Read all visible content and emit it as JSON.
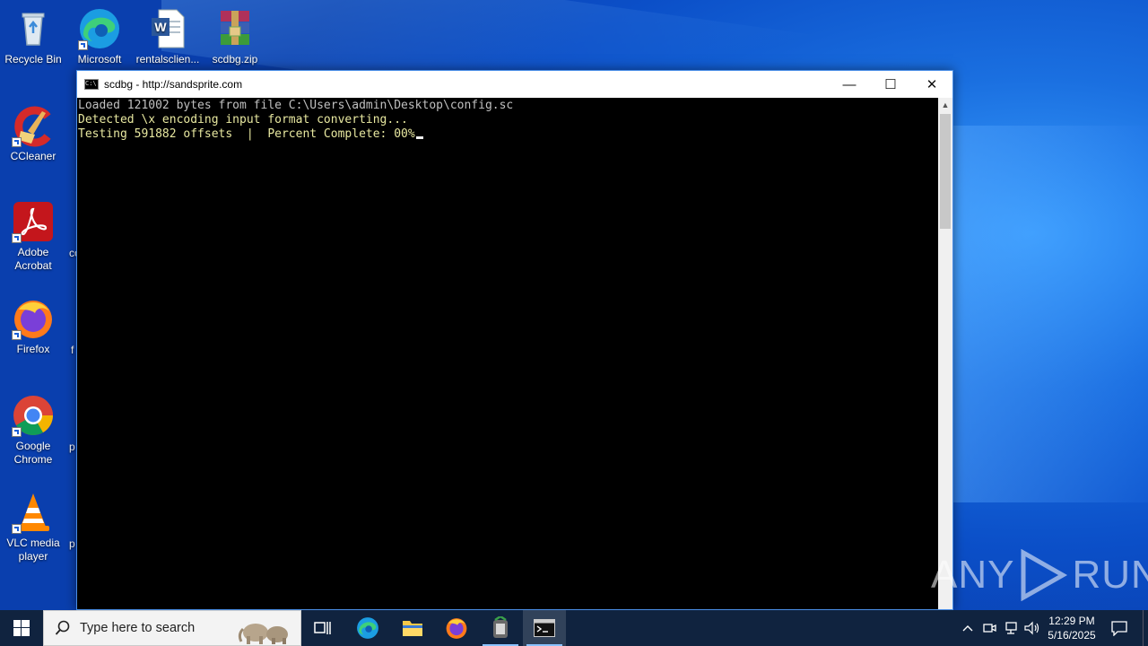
{
  "desktop": {
    "icons": [
      {
        "name": "Recycle Bin",
        "label": "Recycle Bin"
      },
      {
        "name": "Microsoft Edge",
        "label": "Microsoft Edge"
      },
      {
        "name": "rentalsclient",
        "label": "rentalsclien..."
      },
      {
        "name": "scdbg.zip",
        "label": "scdbg.zip"
      },
      {
        "name": "CCleaner",
        "label": "CCleaner"
      },
      {
        "name": "Adobe Acrobat",
        "label": "Adobe Acrobat"
      },
      {
        "name": "Firefox",
        "label": "Firefox"
      },
      {
        "name": "Google Chrome",
        "label": "Google Chrome"
      },
      {
        "name": "VLC media player",
        "label": "VLC media player"
      }
    ],
    "partial_labels": [
      "co",
      "f",
      "p",
      "p"
    ]
  },
  "console_window": {
    "title": "scdbg - http://sandsprite.com",
    "lines": [
      "Loaded 121002 bytes from file C:\\Users\\admin\\Desktop\\config.sc",
      "Detected \\x encoding input format converting...",
      "Testing 591882 offsets  |  Percent Complete: 00%"
    ],
    "controls": {
      "minimize": "—",
      "maximize": "☐",
      "close": "✕"
    }
  },
  "watermark": {
    "left": "ANY",
    "right": "RUN"
  },
  "taskbar": {
    "search_placeholder": "Type here to search",
    "pinned": [
      "Task View",
      "Microsoft Edge",
      "File Explorer",
      "Firefox",
      "scdbg",
      "Command Prompt"
    ],
    "clock_time": "12:29 PM",
    "clock_date": "5/16/2025"
  },
  "colors": {
    "desktop_blue": "#0b4fc8",
    "console_bg": "#000000",
    "console_text": "#c0c0c0",
    "console_yellow": "#e8e8a0",
    "taskbar": "#10233f"
  }
}
